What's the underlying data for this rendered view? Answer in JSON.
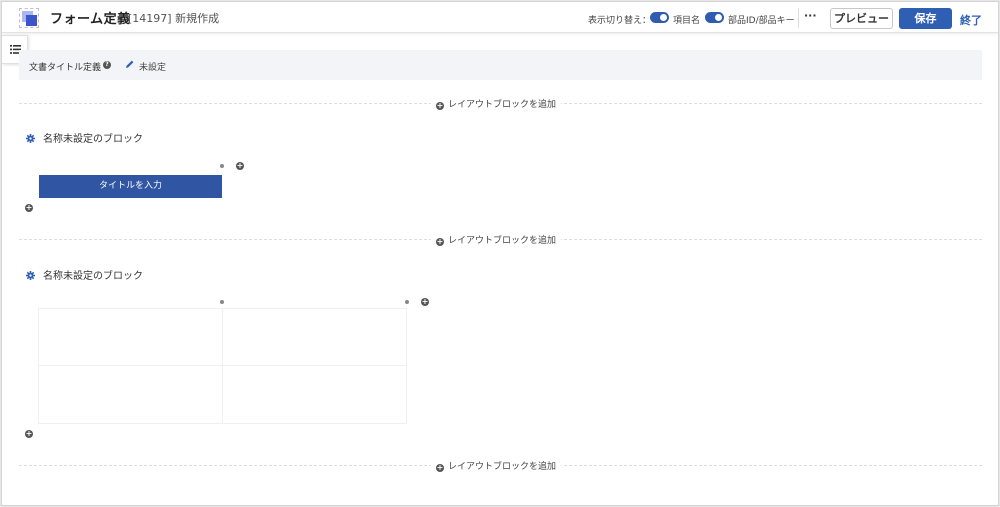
{
  "header": {
    "app_title": "フォーム定義",
    "app_sub": "[14197] 新規作成",
    "display_toggle_label": "表示切り替え：",
    "toggle_item_name_label": "項目名",
    "toggle_part_id_label": "部品ID/部品キー",
    "toggle_item_name_on": true,
    "toggle_part_id_on": true,
    "more_label": "···",
    "preview_label": "プレビュー",
    "save_label": "保存",
    "end_label": "終了"
  },
  "doc_title": {
    "label": "文書タイトル定義",
    "value": "未設定"
  },
  "add_block_label": "レイアウトブロックを追加",
  "blocks": [
    {
      "name": "名称未設定のブロック",
      "field_button_label": "タイトルを入力"
    },
    {
      "name": "名称未設定のブロック"
    }
  ],
  "colors": {
    "accent": "#2f5fb3",
    "field_button": "#2f55a3",
    "doc_bar_bg": "#f2f4f7"
  },
  "icons": [
    "list-icon",
    "help-icon",
    "pencil-icon",
    "plus-circle-icon",
    "gear-icon"
  ]
}
